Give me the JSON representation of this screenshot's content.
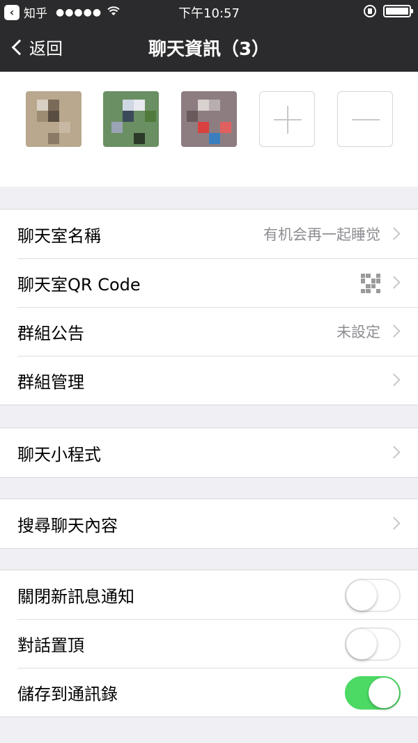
{
  "status_bar": {
    "app_name": "知乎",
    "signal": "●●●●●",
    "time": "下午10:57"
  },
  "nav": {
    "back_label": "返回",
    "title": "聊天資訊（3）"
  },
  "members": {
    "add_symbol": "+",
    "remove_symbol": "−"
  },
  "settings": {
    "chat_name": {
      "label": "聊天室名稱",
      "value": "有机会再一起睡觉"
    },
    "qr_code": {
      "label": "聊天室QR Code"
    },
    "announcement": {
      "label": "群組公告",
      "value": "未設定"
    },
    "group_manage": {
      "label": "群組管理"
    },
    "mini_programs": {
      "label": "聊天小程式"
    },
    "search_content": {
      "label": "搜尋聊天內容"
    },
    "mute": {
      "label": "關閉新訊息通知",
      "on": false
    },
    "pin_top": {
      "label": "對話置頂",
      "on": false
    },
    "save_contacts": {
      "label": "儲存到通訊錄",
      "on": true
    }
  },
  "colors": {
    "nav_bg": "#2b2b2d",
    "toggle_on": "#4cd964",
    "page_bg": "#efeff4"
  }
}
